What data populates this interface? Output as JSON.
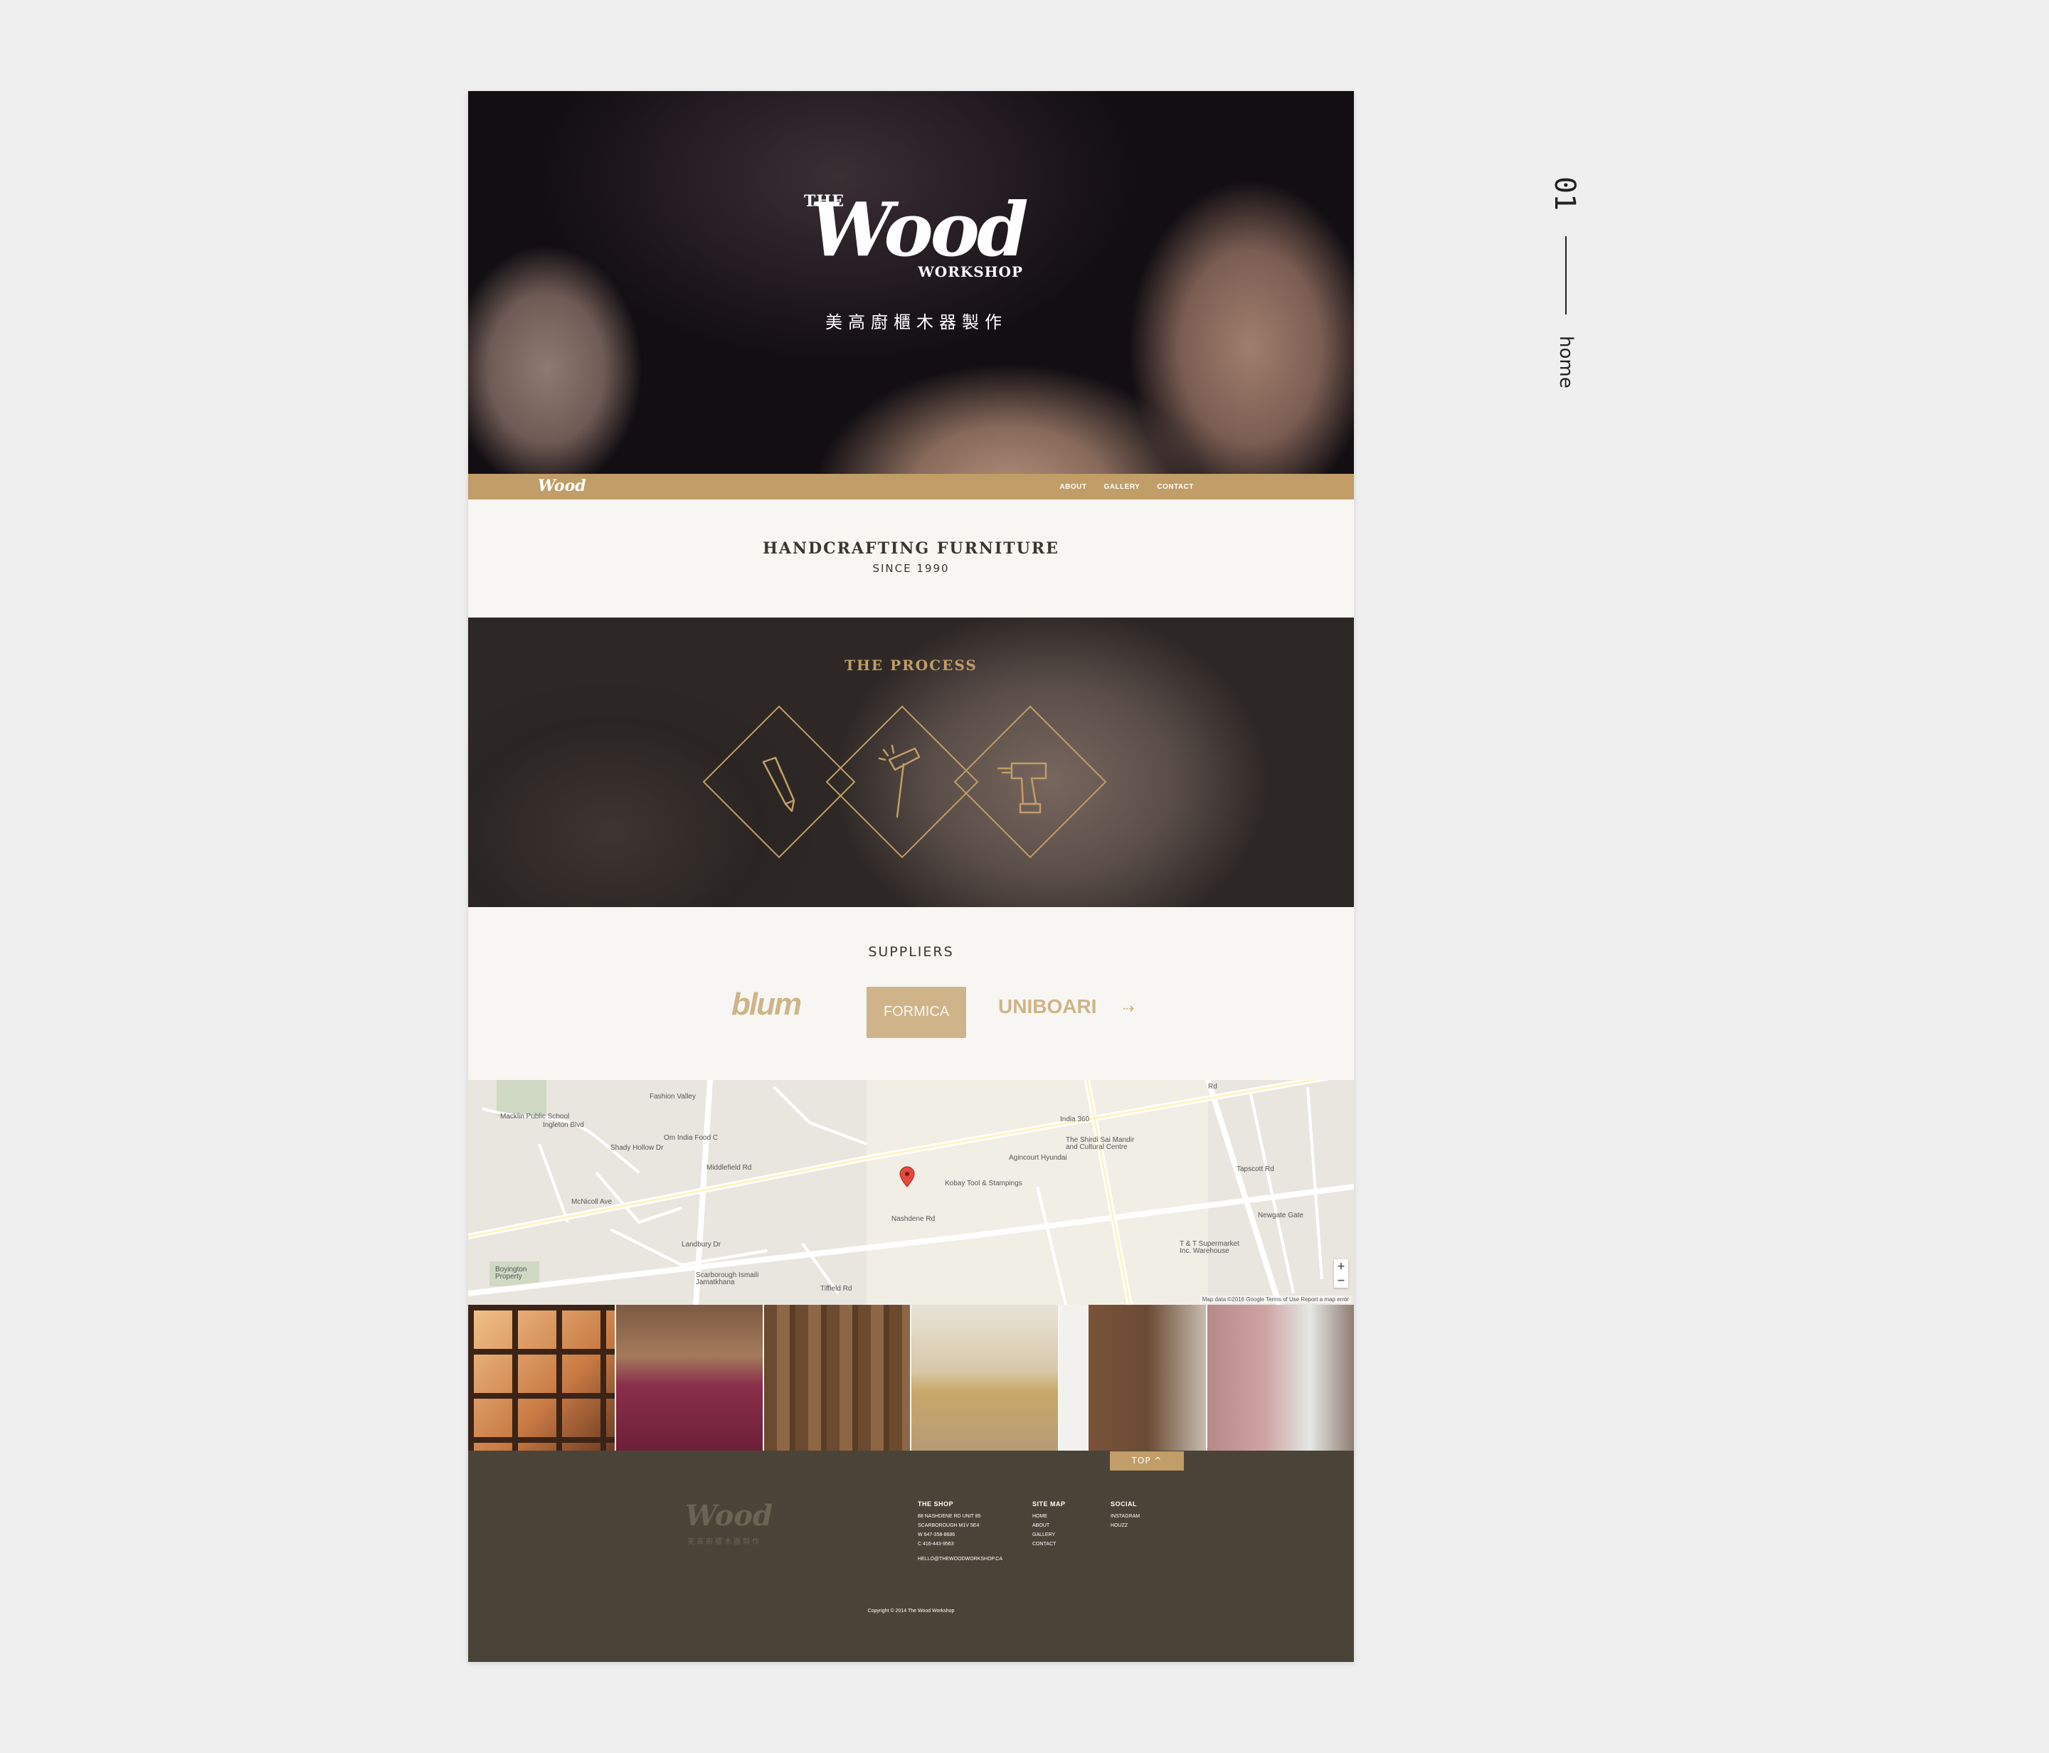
{
  "hero": {
    "logo_the": "THE",
    "logo_wood": "Wood",
    "logo_workshop": "WORKSHOP",
    "tagline_cn": "美高廚櫃木器製作"
  },
  "nav": {
    "logo": "Wood",
    "links": [
      "ABOUT",
      "GALLERY",
      "CONTACT"
    ]
  },
  "intro": {
    "title": "HANDCRAFTING FURNITURE",
    "subtitle": "SINCE 1990"
  },
  "process": {
    "title": "THE PROCESS",
    "icons": [
      "pencil-icon",
      "hammer-icon",
      "drill-icon"
    ],
    "accent": "#c19d67"
  },
  "suppliers": {
    "title": "SUPPLIERS",
    "logos": [
      "blum",
      "FORMICA",
      "UNIBOARI"
    ],
    "next": "⇢"
  },
  "map": {
    "labels": [
      "Fashion Valley",
      "Macklin Public School",
      "Om India Food C",
      "McNicoll Ave",
      "India 360",
      "The Shirdi Sai Mandir and Cultural Centre",
      "Agincourt Hyundai",
      "Kobay Tool & Stampings",
      "Nashdene Rd",
      "T & T Supermarket Inc. Warehouse",
      "Boyington Property",
      "Scarborough Ismaili Jamatkhana",
      "Tiffield Rd",
      "Landbury Dr",
      "Middlefield Rd",
      "Tapscott Rd",
      "Newgate Gate",
      "Ingleton Blvd",
      "Shady Hollow Dr",
      "Rd"
    ],
    "zoom_in": "+",
    "zoom_out": "−",
    "footer": "Map data ©2016 Google   Terms of Use   Report a map error"
  },
  "top_button": "TOP ^",
  "footer": {
    "logo": "Wood",
    "logo_cn": "美高廚櫃木器製作",
    "shop": {
      "heading": "THE SHOP",
      "lines": [
        "88 NASHDENE RD    UNIT 85",
        "SCARBOROUGH    M1V 5E4",
        "W    647-358-8686",
        "C    416-443-9563",
        "",
        "HELLO@THEWOODWORKSHOP.CA"
      ]
    },
    "sitemap": {
      "heading": "SITE MAP",
      "links": [
        "HOME",
        "ABOUT",
        "GALLERY",
        "CONTACT"
      ]
    },
    "social": {
      "heading": "SOCIAL",
      "links": [
        "INSTAGRAM",
        "HOUZZ"
      ]
    },
    "copyright": "Copyright © 2014 The Wood Workshop"
  },
  "side": {
    "number": "01",
    "word": "home"
  }
}
